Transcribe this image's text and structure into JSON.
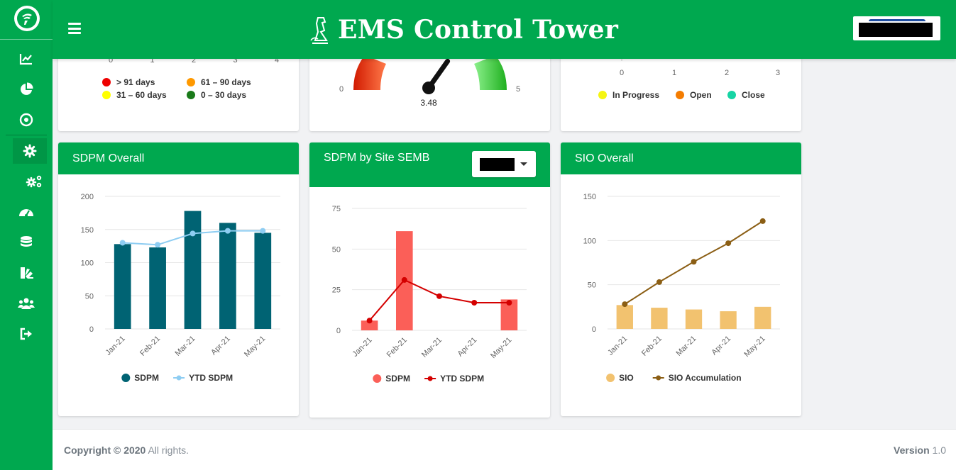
{
  "app": {
    "title": "EMS Control Tower"
  },
  "sidebar": {
    "items": [
      {
        "icon": "line-chart-icon"
      },
      {
        "icon": "pie-chart-icon"
      },
      {
        "icon": "target-icon"
      },
      {
        "icon": "settings-gear-icon",
        "active": true
      },
      {
        "icon": "cogs-icon"
      },
      {
        "icon": "dashboard-gauge-icon"
      },
      {
        "icon": "database-icon"
      },
      {
        "icon": "palette-icon"
      },
      {
        "icon": "users-icon"
      },
      {
        "icon": "sign-out-icon"
      }
    ]
  },
  "top_cards": {
    "aging": {
      "legend": [
        {
          "label": "> 91 days",
          "color": "#ee0000"
        },
        {
          "label": "61 – 90 days",
          "color": "#ff9900"
        },
        {
          "label": "31 – 60 days",
          "color": "#ffff00"
        },
        {
          "label": "0 – 30 days",
          "color": "#1a7a1a"
        }
      ],
      "partial_ticks": [
        "0",
        "1",
        "2",
        "3",
        "4"
      ]
    },
    "gauge": {
      "min_label": "0",
      "max_label": "5",
      "value_label": "3.48",
      "value": 3.48
    },
    "status": {
      "ticks": [
        "0",
        "1",
        "2",
        "3"
      ],
      "legend": [
        {
          "label": "In Progress",
          "color": "#f5f512"
        },
        {
          "label": "Open",
          "color": "#f47c00"
        },
        {
          "label": "Close",
          "color": "#16d4a4"
        }
      ]
    }
  },
  "chart_data": [
    {
      "type": "bar",
      "title": "SDPM Overall",
      "categories": [
        "Jan-21",
        "Feb-21",
        "Mar-21",
        "Apr-21",
        "May-21"
      ],
      "yticks": [
        "0",
        "50",
        "100",
        "150",
        "200"
      ],
      "ylim": [
        0,
        200
      ],
      "series": [
        {
          "name": "SDPM",
          "type": "bar",
          "color": "#006373",
          "values": [
            128,
            123,
            178,
            160,
            145
          ]
        },
        {
          "name": "YTD SDPM",
          "type": "line",
          "color": "#8ecdf2",
          "values": [
            130,
            127,
            144,
            148,
            148
          ]
        }
      ],
      "legend_position": "bottom"
    },
    {
      "type": "bar",
      "title": "SDPM by Site SEMB",
      "categories": [
        "Jan-21",
        "Feb-21",
        "Mar-21",
        "Apr-21",
        "May-21"
      ],
      "yticks": [
        "0",
        "25",
        "50",
        "75"
      ],
      "ylim": [
        0,
        75
      ],
      "series": [
        {
          "name": "SDPM",
          "type": "bar",
          "color": "#fb5f58",
          "values": [
            6,
            61,
            0,
            0,
            19
          ]
        },
        {
          "name": "YTD SDPM",
          "type": "line",
          "color": "#d40000",
          "values": [
            6,
            31,
            21,
            17,
            17
          ]
        }
      ],
      "legend_position": "bottom"
    },
    {
      "type": "bar",
      "title": "SIO Overall",
      "categories": [
        "Jan-21",
        "Feb-21",
        "Mar-21",
        "Apr-21",
        "May-21"
      ],
      "yticks": [
        "0",
        "50",
        "100",
        "150"
      ],
      "ylim": [
        0,
        150
      ],
      "series": [
        {
          "name": "SIO",
          "type": "bar",
          "color": "#f2c26f",
          "values": [
            27,
            24,
            22,
            20,
            25
          ]
        },
        {
          "name": "SIO Accumulation",
          "type": "line",
          "color": "#8b5e14",
          "values": [
            28,
            53,
            76,
            97,
            122
          ]
        }
      ],
      "legend_position": "bottom"
    }
  ],
  "footer": {
    "copyright_bold": "Copyright © 2020",
    "copyright_rest": " All rights.",
    "version_label": "Version",
    "version_value": " 1.0"
  }
}
